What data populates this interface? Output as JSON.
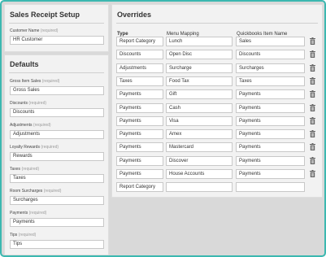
{
  "receipt": {
    "title": "Sales Receipt Setup",
    "customer": {
      "label": "Customer Name",
      "req": "(required)",
      "value": "HR Customer"
    }
  },
  "defaults": {
    "title": "Defaults",
    "fields": [
      {
        "label": "Gross Item Sales",
        "req": "(required)",
        "value": "Gross Sales"
      },
      {
        "label": "Discounts",
        "req": "(required)",
        "value": "Discounts"
      },
      {
        "label": "Adjustments",
        "req": "(required)",
        "value": "Adjustments"
      },
      {
        "label": "Loyalty Rewards",
        "req": "(required)",
        "value": "Rewards"
      },
      {
        "label": "Taxes",
        "req": "(required)",
        "value": "Taxes"
      },
      {
        "label": "Room Surcharges",
        "req": "(required)",
        "value": "Surcharges"
      },
      {
        "label": "Payments",
        "req": "(required)",
        "value": "Payments"
      },
      {
        "label": "Tips",
        "req": "(required)",
        "value": "Tips"
      }
    ]
  },
  "overrides": {
    "title": "Overrides",
    "headers": {
      "type": "Type",
      "mapping": "Menu Mapping",
      "qb": "Quickbooks Item Name"
    },
    "rows": [
      {
        "type": "Report Category",
        "mapping": "Lunch",
        "qb": "Sales"
      },
      {
        "type": "Discounts",
        "mapping": "Open Disc",
        "qb": "Discounts"
      },
      {
        "type": "Adjustments",
        "mapping": "Surcharge",
        "qb": "Surcharges"
      },
      {
        "type": "Taxes",
        "mapping": "Food Tax",
        "qb": "Taxes"
      },
      {
        "type": "Payments",
        "mapping": "Gift",
        "qb": "Payments"
      },
      {
        "type": "Payments",
        "mapping": "Cash",
        "qb": "Payments"
      },
      {
        "type": "Payments",
        "mapping": "Visa",
        "qb": "Payments"
      },
      {
        "type": "Payments",
        "mapping": "Amex",
        "qb": "Payments"
      },
      {
        "type": "Payments",
        "mapping": "Mastercard",
        "qb": "Payments"
      },
      {
        "type": "Payments",
        "mapping": "Discover",
        "qb": "Payments"
      },
      {
        "type": "Payments",
        "mapping": "House Accounts",
        "qb": "Payments"
      }
    ],
    "new_row": {
      "type": "Report Category",
      "mapping": "",
      "qb": ""
    }
  }
}
